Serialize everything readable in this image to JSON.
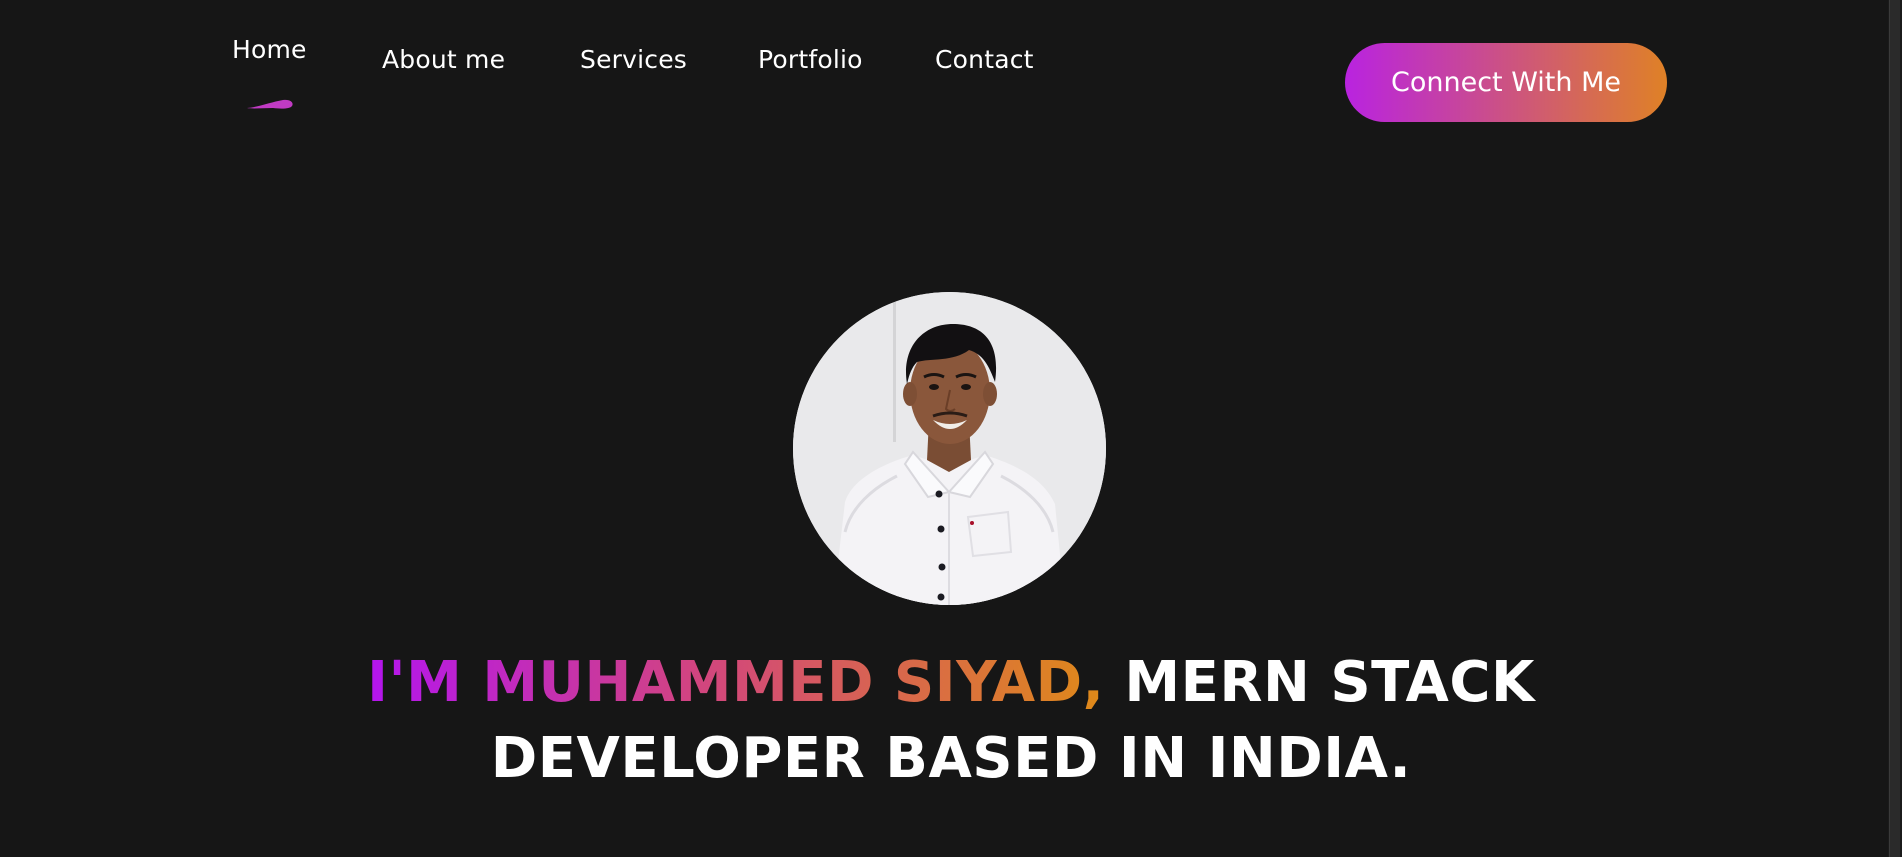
{
  "nav": {
    "items": [
      {
        "label": "Home",
        "active": true
      },
      {
        "label": "About me"
      },
      {
        "label": "Services"
      },
      {
        "label": "Portfolio"
      },
      {
        "label": "Contact"
      }
    ],
    "active_indicator_color": "#c13bc4"
  },
  "cta": {
    "label": "Connect With Me",
    "gradient": [
      "#b923e0",
      "#df8126"
    ]
  },
  "hero": {
    "avatar_icon": "profile-photo",
    "headline_highlight": "I'M MUHAMMED SIYAD,",
    "headline_line1_rest": " MERN STACK",
    "headline_line2": "DEVELOPER BASED IN INDIA.",
    "highlight_gradient": [
      "#b415ef",
      "#d2457f",
      "#df8a18"
    ]
  },
  "colors": {
    "background": "#161616",
    "text": "#ffffff"
  }
}
